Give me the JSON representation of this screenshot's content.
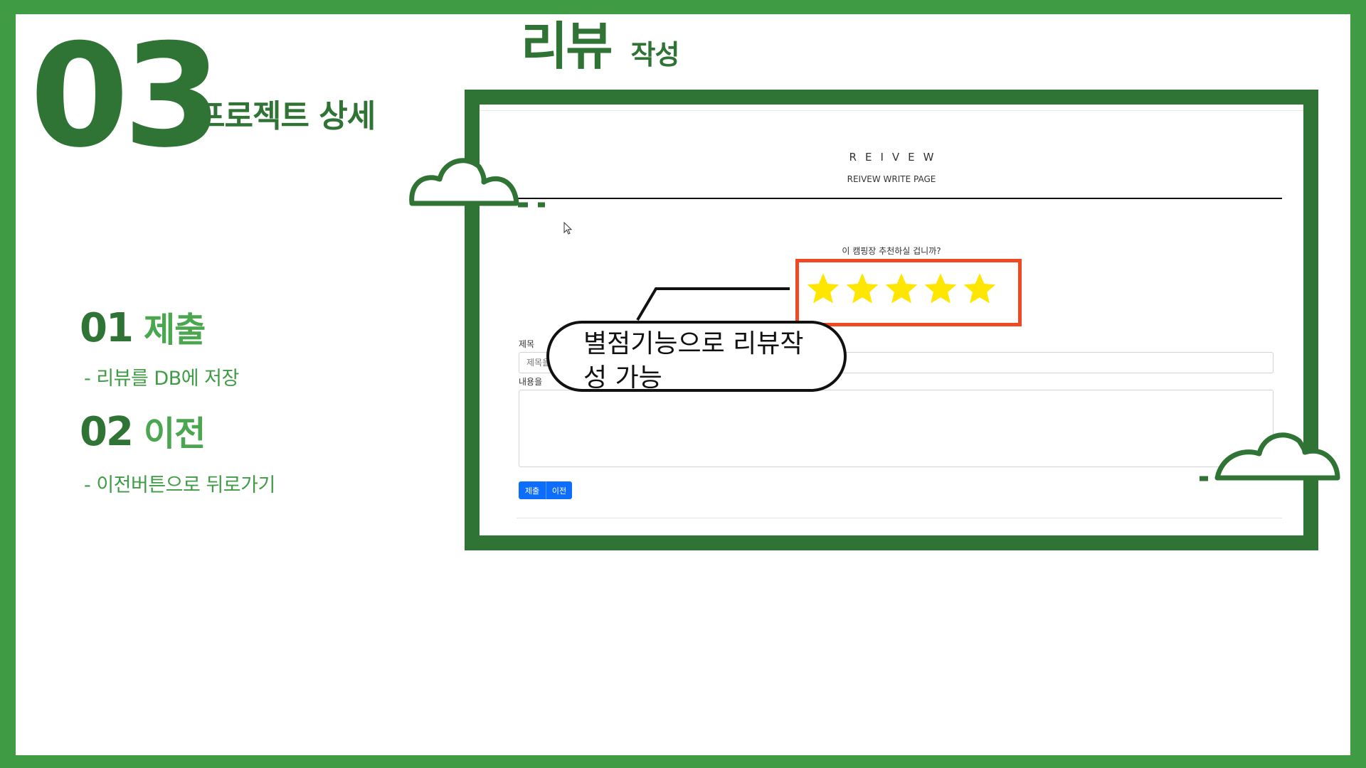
{
  "slide": {
    "number": "03",
    "subtitle": "프로젝트 상세",
    "title": "리뷰",
    "title_sub": "작성",
    "colors": {
      "dark_green": "#2f7335",
      "green": "#3f9c45",
      "light_green": "#4aa64f",
      "highlight_red": "#f04a24"
    }
  },
  "features": [
    {
      "number": "01",
      "name": "제출",
      "description": "- 리뷰를 DB에 저장"
    },
    {
      "number": "02",
      "name": "이전",
      "description": "- 이전버튼으로 뒤로가기"
    }
  ],
  "screenshot": {
    "page_letters": "REIVEW",
    "page_subtitle": "REIVEW WRITE PAGE",
    "question": "이 캠핑장 추천하실 겁니까?",
    "rating": {
      "value": 5,
      "max": 5,
      "star_color": "#ffe600"
    },
    "title_field": {
      "label": "제목",
      "placeholder": "제목을"
    },
    "content_field": {
      "label": "내용을"
    },
    "buttons": {
      "submit": "제출",
      "prev": "이전"
    },
    "accent_color": "#0d6efd"
  },
  "callout": {
    "line1": "별점기능으로 리뷰작",
    "line2": "성 가능"
  },
  "icons": [
    "cloud-icon",
    "star-icon",
    "cursor-icon"
  ]
}
